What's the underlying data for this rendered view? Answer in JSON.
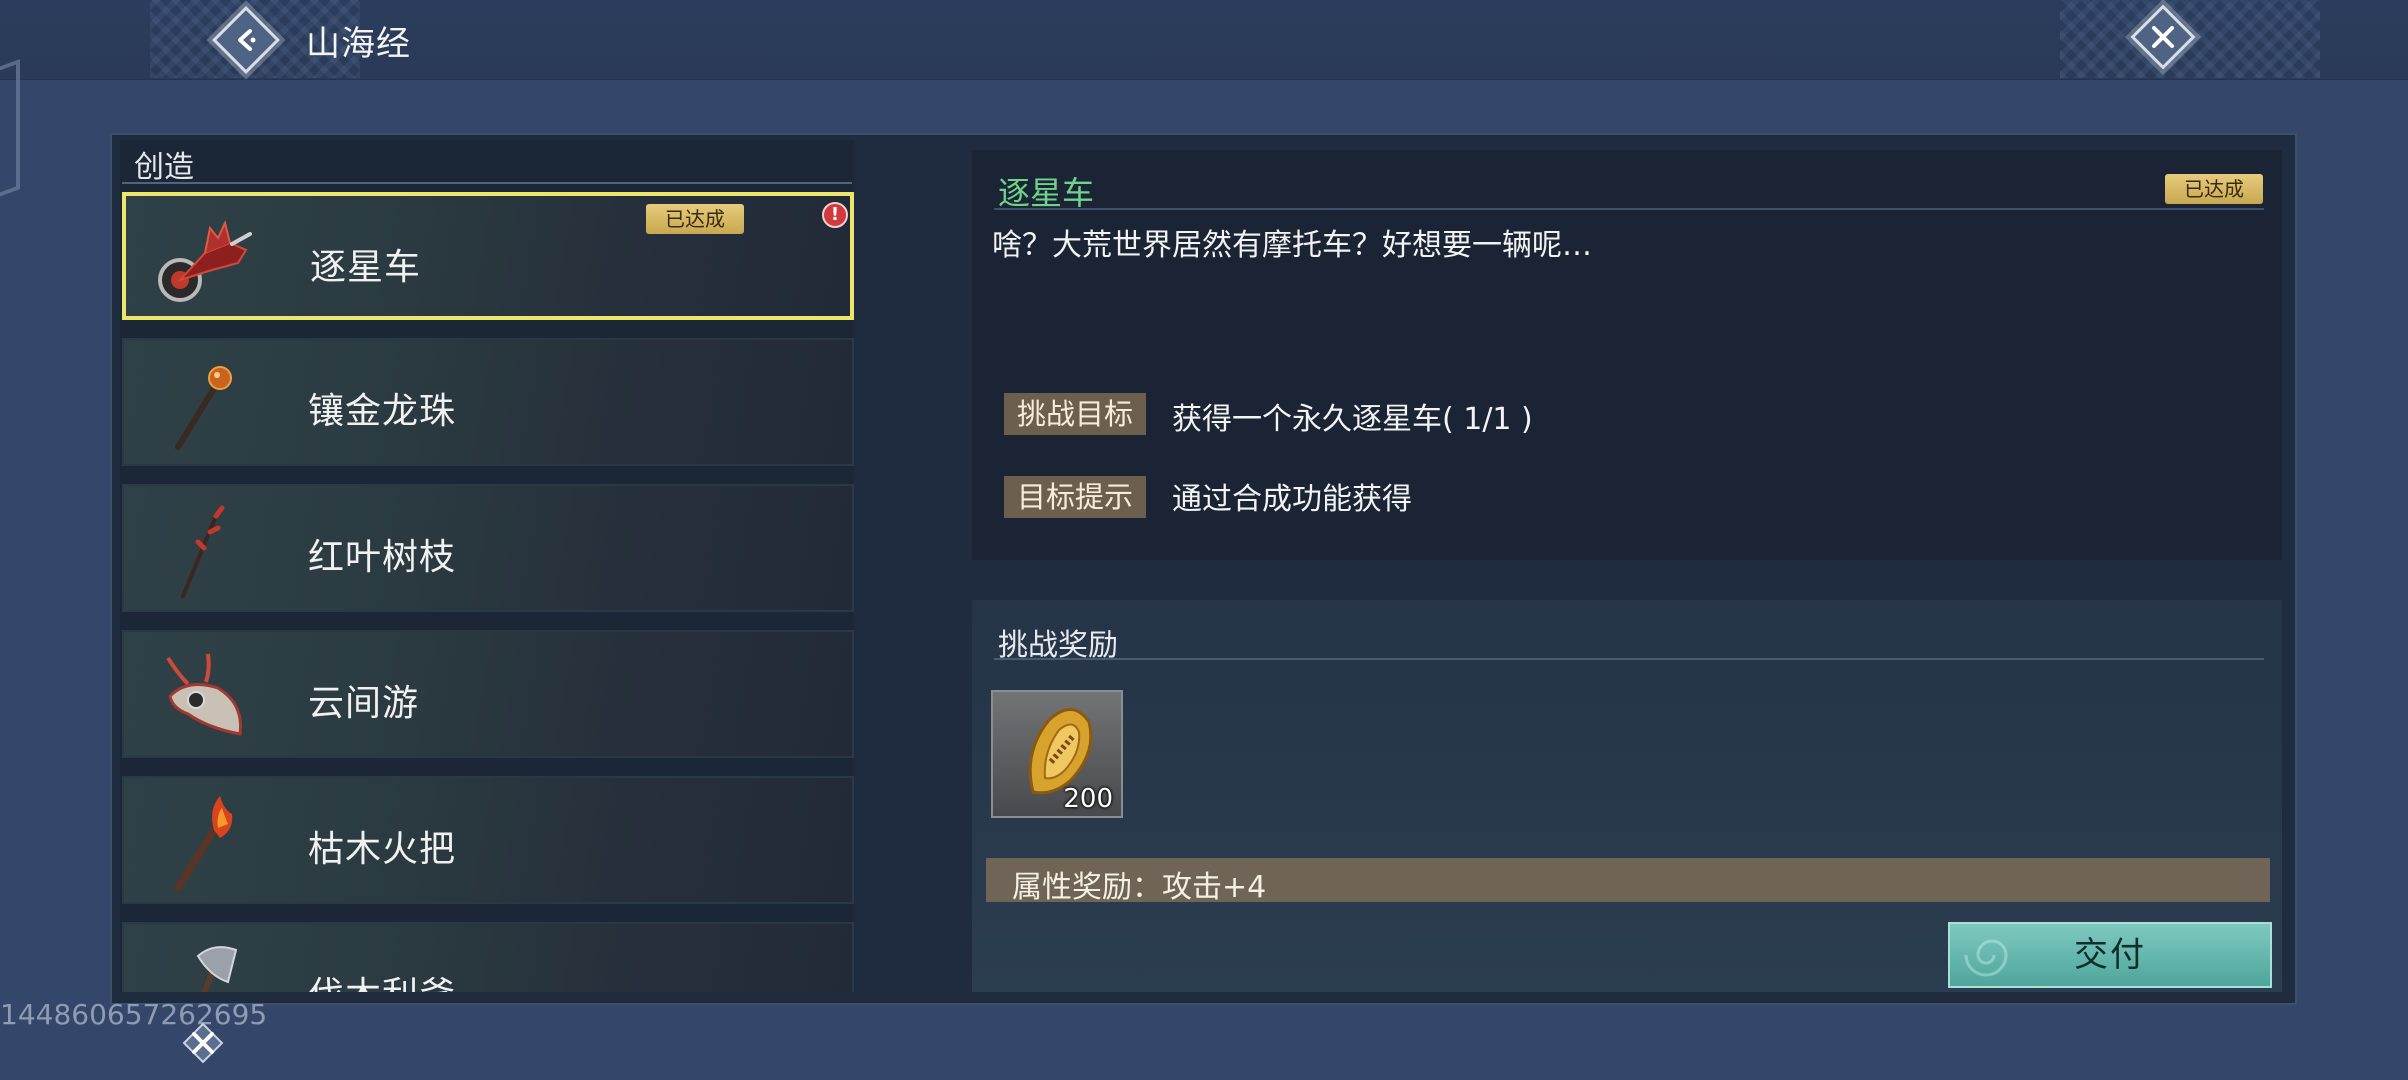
{
  "header": {
    "title": "山海经"
  },
  "list": {
    "header": "创造",
    "items": [
      {
        "label": "逐星车",
        "achieved_tag": "已达成",
        "alert": "!"
      },
      {
        "label": "镶金龙珠"
      },
      {
        "label": "红叶树枝"
      },
      {
        "label": "云间游"
      },
      {
        "label": "枯木火把"
      },
      {
        "label": "伐木利斧"
      }
    ]
  },
  "detail": {
    "title": "逐星车",
    "achieved_tag": "已达成",
    "description": "啥？大荒世界居然有摩托车？好想要一辆呢…",
    "goal_label": "挑战目标",
    "goal_value": "获得一个永久逐星车( 1/1 )",
    "hint_label": "目标提示",
    "hint_value": "通过合成功能获得"
  },
  "rewards": {
    "title": "挑战奖励",
    "items": [
      {
        "icon": "gold-seed-icon",
        "count": "200"
      }
    ],
    "attribute_text": "属性奖励：攻击+4",
    "submit_label": "交付"
  },
  "footer": {
    "player_id": "144860657262695"
  },
  "colors": {
    "accent_green": "#6fd38a",
    "selected_border": "#ece66a",
    "submit_button": "#5fb3a9",
    "tag_gold": "#d8ba64"
  }
}
